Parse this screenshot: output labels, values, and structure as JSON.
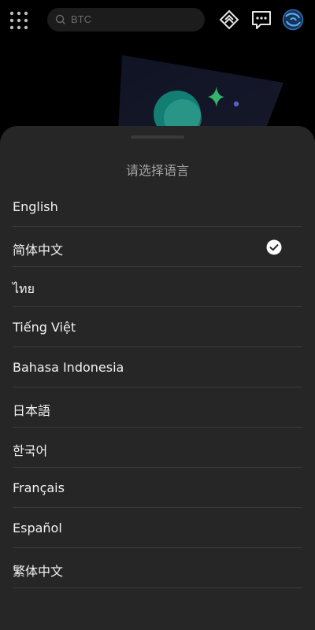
{
  "search": {
    "placeholder": "BTC"
  },
  "sheet": {
    "title": "请选择语言",
    "selected_index": 1,
    "languages": [
      {
        "label": "English",
        "selected": false
      },
      {
        "label": "简体中文",
        "selected": true
      },
      {
        "label": "ไทย",
        "selected": false
      },
      {
        "label": "Tiếng Việt",
        "selected": false
      },
      {
        "label": "Bahasa Indonesia",
        "selected": false
      },
      {
        "label": "日本語",
        "selected": false
      },
      {
        "label": "한국어",
        "selected": false
      },
      {
        "label": "Français",
        "selected": false
      },
      {
        "label": "Español",
        "selected": false
      },
      {
        "label": "繁体中文",
        "selected": false
      }
    ]
  },
  "colors": {
    "sheet_bg": "#262626",
    "text_primary": "#f2f2f2",
    "text_secondary": "#a3a3a3",
    "divider": "#3a3a3a",
    "accent_teal": "#1a9e8f",
    "accent_blue": "#2f6fb5"
  },
  "icons": {
    "menu": "grid-menu-icon",
    "search": "search-icon",
    "top_right_1": "diamond-exchange-icon",
    "top_right_2": "message-icon",
    "top_right_3": "avatar-globe-icon",
    "selected": "check-circle-icon"
  }
}
